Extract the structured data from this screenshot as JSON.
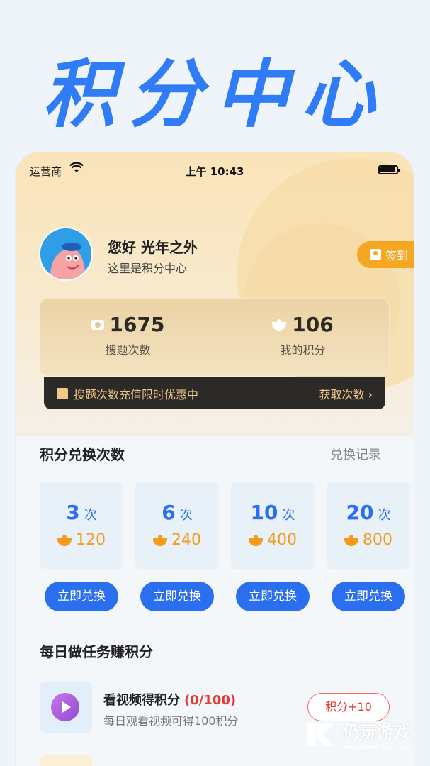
{
  "hero": {
    "title": "积分中心"
  },
  "status_bar": {
    "carrier": "运营商",
    "time": "上午 10:43"
  },
  "profile": {
    "greeting": "您好 光年之外",
    "subtitle": "这里是积分中心",
    "signin_label": "签到"
  },
  "stats": [
    {
      "value": "1675",
      "label": "搜题次数",
      "icon": "camera-icon"
    },
    {
      "value": "106",
      "label": "我的积分",
      "icon": "points-leaf-icon"
    }
  ],
  "promo": {
    "text": "搜题次数充值限时优惠中",
    "link": "获取次数 ›"
  },
  "exchange": {
    "title": "积分兑换次数",
    "record_link": "兑换记录",
    "unit": "次",
    "button_label": "立即兑换",
    "options": [
      {
        "times": "3",
        "cost": "120"
      },
      {
        "times": "6",
        "cost": "240"
      },
      {
        "times": "10",
        "cost": "400"
      },
      {
        "times": "20",
        "cost": "800"
      }
    ]
  },
  "tasks": {
    "title": "每日做任务赚积分",
    "items": [
      {
        "title": "看视频得积分",
        "progress": "(0/100)",
        "desc": "每日观看视频可得100积分",
        "button": "积分+10"
      }
    ]
  },
  "watermark": {
    "cn": "仍玩游戏",
    "en": "Rengwan Games"
  },
  "colors": {
    "accent": "#2a6ff0",
    "orange": "#f5a623",
    "red": "#e53935"
  }
}
